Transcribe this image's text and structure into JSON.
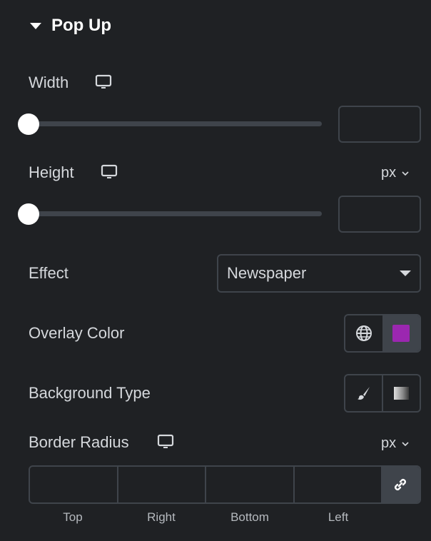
{
  "section": {
    "title": "Pop Up",
    "icon": "caret-down-icon"
  },
  "width": {
    "label": "Width",
    "icon": "monitor-icon",
    "slider_value": 0,
    "input_value": ""
  },
  "height": {
    "label": "Height",
    "icon": "monitor-icon",
    "unit": "px",
    "slider_value": 0,
    "input_value": ""
  },
  "effect": {
    "label": "Effect",
    "selected": "Newspaper"
  },
  "overlay_color": {
    "label": "Overlay Color",
    "global_icon": "globe-icon",
    "swatch_color": "#9b27b0"
  },
  "background_type": {
    "label": "Background Type",
    "options": [
      "classic-brush-icon",
      "gradient-icon"
    ]
  },
  "border_radius": {
    "label": "Border Radius",
    "icon": "monitor-icon",
    "unit": "px",
    "fields": [
      {
        "label": "Top",
        "value": ""
      },
      {
        "label": "Right",
        "value": ""
      },
      {
        "label": "Bottom",
        "value": ""
      },
      {
        "label": "Left",
        "value": ""
      }
    ],
    "link_icon": "link-icon"
  }
}
